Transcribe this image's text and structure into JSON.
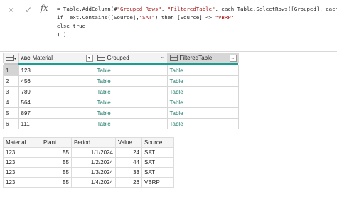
{
  "formula_bar": {
    "cancel_icon": "×",
    "confirm_icon": "✓",
    "fx_label": "fx",
    "line1_a": "= Table.AddColumn(#",
    "line1_s1": "\"Grouped Rows\"",
    "line1_b": ", ",
    "line1_s2": "\"FilteredTable\"",
    "line1_c": ", each Table.SelectRows([Grouped], each",
    "line2_a": "if Text.Contains([Source],",
    "line2_s1": "\"SAT\"",
    "line2_b": ") then [Source] <> ",
    "line2_s2": "\"VBRP\"",
    "line3": "else true",
    "line4": ") )"
  },
  "grid": {
    "columns": [
      {
        "label": "Material",
        "type_icon": "ABC"
      },
      {
        "label": "Grouped",
        "type_icon": "table"
      },
      {
        "label": "FilteredTable",
        "type_icon": "table"
      }
    ],
    "rows": [
      {
        "num": "1",
        "material": "123",
        "grouped": "Table",
        "filtered": "Table"
      },
      {
        "num": "2",
        "material": "456",
        "grouped": "Table",
        "filtered": "Table"
      },
      {
        "num": "3",
        "material": "789",
        "grouped": "Table",
        "filtered": "Table"
      },
      {
        "num": "4",
        "material": "564",
        "grouped": "Table",
        "filtered": "Table"
      },
      {
        "num": "5",
        "material": "897",
        "grouped": "Table",
        "filtered": "Table"
      },
      {
        "num": "6",
        "material": "111",
        "grouped": "Table",
        "filtered": "Table"
      }
    ]
  },
  "result": {
    "headers": [
      "Material",
      "Plant",
      "Period",
      "Value",
      "Source"
    ],
    "rows": [
      [
        "123",
        "55",
        "1/1/2024",
        "24",
        "SAT"
      ],
      [
        "123",
        "55",
        "1/2/2024",
        "44",
        "SAT"
      ],
      [
        "123",
        "55",
        "1/3/2024",
        "33",
        "SAT"
      ],
      [
        "123",
        "55",
        "1/4/2024",
        "26",
        "VBRP"
      ]
    ]
  },
  "colors": {
    "accent": "#1a9e91",
    "table_link": "#1e7a6a",
    "string": "#a31515"
  }
}
